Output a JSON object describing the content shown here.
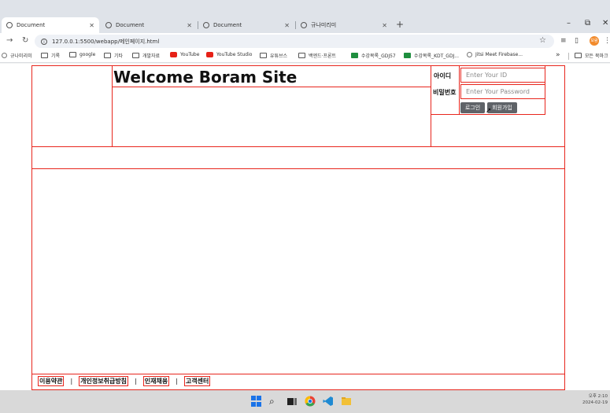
{
  "browser": {
    "tabs": [
      {
        "label": "Document",
        "active": true
      },
      {
        "label": "Document",
        "active": false
      },
      {
        "label": "Document",
        "active": false
      },
      {
        "label": "규나미리미",
        "active": false
      }
    ],
    "new_tab": "+",
    "window_buttons": {
      "minimize": "–",
      "restore": "⧉",
      "close": "✕"
    },
    "url": "127.0.0.1:5500/webapp/메인페이지.html",
    "profile_initials": "보람",
    "bookmarks": [
      {
        "label": "규나미리미",
        "icon": "page"
      },
      {
        "label": "기록",
        "icon": "folder"
      },
      {
        "label": "google",
        "icon": "folder"
      },
      {
        "label": "기타",
        "icon": "folder"
      },
      {
        "label": "개발자료",
        "icon": "folder"
      },
      {
        "label": "YouTube",
        "icon": "youtube"
      },
      {
        "label": "YouTube Studio",
        "icon": "youtube"
      },
      {
        "label": "유튜브스",
        "icon": "folder"
      },
      {
        "label": "백엔드·프론트",
        "icon": "folder"
      },
      {
        "label": "수강목록_GDJ57",
        "icon": "sheet"
      },
      {
        "label": "수강목록_KDT_GDJ...",
        "icon": "sheet"
      },
      {
        "label": "Jitsi Meet Firebase...",
        "icon": "page"
      }
    ],
    "bookmarks_more": "»",
    "other_bookmarks": "모든 북마크"
  },
  "page": {
    "site_title": "Welcome Boram Site",
    "login": {
      "id_label": "아이디",
      "id_placeholder": "Enter Your ID",
      "pw_label": "비밀번호",
      "pw_placeholder": "Enter Your Password",
      "login_button": "로그인",
      "join_button": "회원가입"
    },
    "footer_links": [
      "이용약관",
      "개인정보취급방침",
      "인재채용",
      "고객센터"
    ],
    "footer_separator": "|"
  },
  "taskbar": {
    "clock_line1": "오후 2:10",
    "clock_line2": "2024-02-19"
  },
  "colors": {
    "border_red": "#e8261d",
    "button_gray": "#5f6368"
  }
}
